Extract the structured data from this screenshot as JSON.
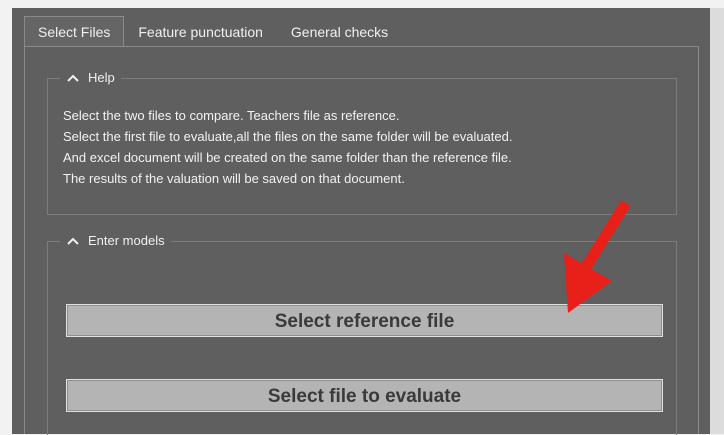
{
  "tabs": [
    {
      "label": "Select Files",
      "active": true
    },
    {
      "label": "Feature punctuation",
      "active": false
    },
    {
      "label": "General checks",
      "active": false
    }
  ],
  "help": {
    "title": "Help",
    "lines": [
      "Select the two files to compare. Teachers file as reference.",
      "Select the first file to evaluate,all the files on the same folder will be evaluated.",
      "And excel document will be created on the same folder than the reference  file.",
      "The results of the valuation will be saved on that document."
    ]
  },
  "models": {
    "title": "Enter models",
    "select_reference_label": "Select reference file",
    "select_evaluate_label": "Select file to evaluate"
  },
  "colors": {
    "panel": "#5f5f5f",
    "button": "#b4b4b4",
    "arrow": "#e8201a"
  }
}
